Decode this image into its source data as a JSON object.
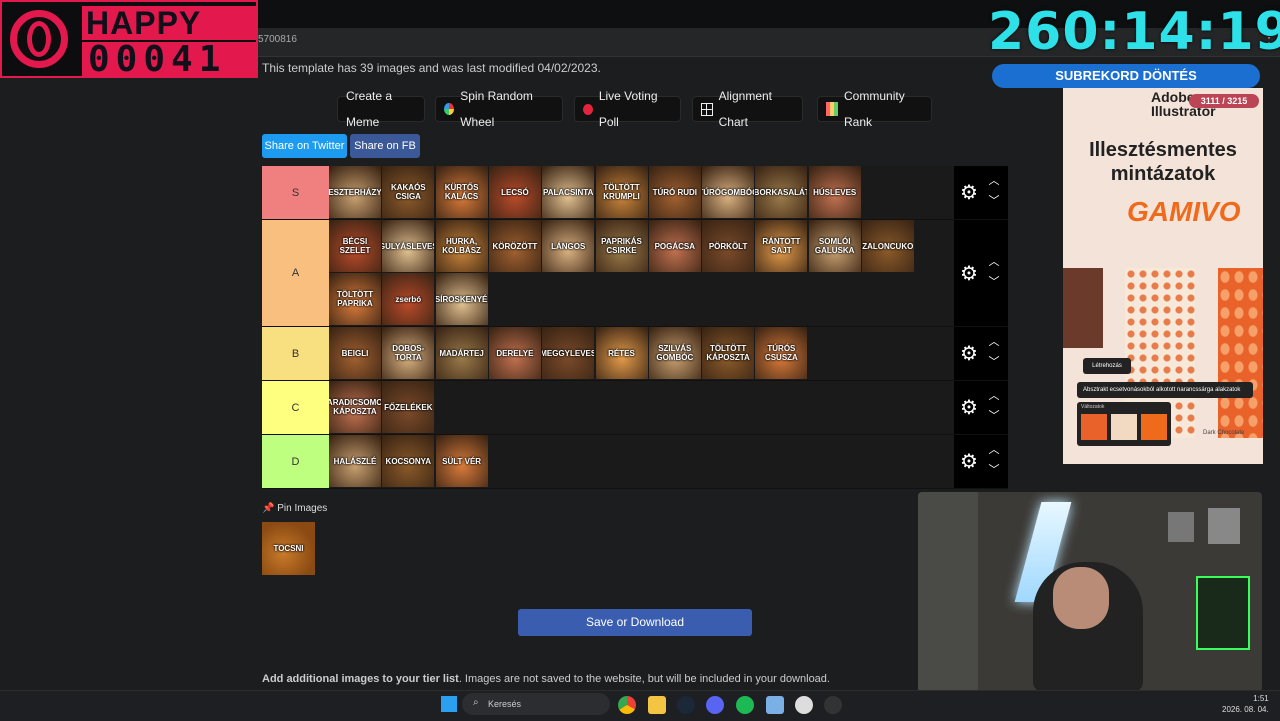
{
  "browser": {
    "url_fragment": "5700816"
  },
  "logo": {
    "line1": "HAPPY PCs",
    "line2": "00041"
  },
  "stream": {
    "timer": "260:14:19",
    "sub_banner": "SUBREKORD DÖNTÉS"
  },
  "template_info": "This template has 39 images and was last modified 04/02/2023.",
  "toolbar": {
    "create_meme": "Create a Meme",
    "spin_wheel": "Spin Random Wheel",
    "live_poll": "Live Voting Poll",
    "alignment": "Alignment Chart",
    "community": "Community Rank"
  },
  "share": {
    "twitter": "Share on Twitter",
    "fb": "Share on FB"
  },
  "tiers": [
    {
      "label": "S",
      "color": "#f07f7f"
    },
    {
      "label": "A",
      "color": "#f8bf7f"
    },
    {
      "label": "B",
      "color": "#f8df7f"
    },
    {
      "label": "C",
      "color": "#ffff7f"
    },
    {
      "label": "D",
      "color": "#bfff7f"
    }
  ],
  "tier_items": {
    "S": [
      "ESZTERHÁZY",
      "KAKAÓS CSIGA",
      "KÜRTŐS KALÁCS",
      "LECSÓ",
      "PALACSINTA",
      "TÖLTÖTT KRUMPLI",
      "TÚRÓ RUDI",
      "TÚRÓGOMBÓC",
      "UBORKASALÁTA",
      "HÚSLEVES"
    ],
    "A": [
      "BÉCSI SZELET",
      "GULYÁSLEVES",
      "HURKA, KOLBÁSZ",
      "KÖRÖZÖTT",
      "LÁNGOS",
      "PAPRIKÁS CSIRKE",
      "POGÁCSA",
      "PÖRKÖLT",
      "RÁNTOTT SAJT",
      "SOMLÓI GALUSKA",
      "SZALONCUKOR",
      "TÖLTÖTT PAPRIKA",
      "zserbó",
      "ZSÍROSKENYÉR"
    ],
    "B": [
      "BEIGLI",
      "DOBOS-TORTA",
      "MADÁRTEJ",
      "DERELYE",
      "MEGGYLEVES",
      "RÉTES",
      "SZILVÁS GOMBÓC",
      "TÖLTÖTT KÁPOSZTA",
      "TÚRÓS CSUSZA"
    ],
    "C": [
      "PARADICSOMOS KÁPOSZTA",
      "FŐZELÉKEK"
    ],
    "D": [
      "HALÁSZLÉ",
      "KOCSONYA",
      "SÜLT VÉR"
    ]
  },
  "pin": {
    "label": "Pin Images",
    "item": "TOCSNI"
  },
  "save_label": "Save or Download",
  "add_images": {
    "bold": "Add additional images to your tier list",
    "rest": ". Images are not saved to the website, but will be included in your download."
  },
  "ad": {
    "brand": "Adobe Illustrator",
    "counter": "3111 / 3215",
    "headline": "Illesztésmentes mintázatok",
    "sponsor": "GAMIVO",
    "chip1": "Létrehozás",
    "prompt": "Absztrakt ecsetvonásokból alkotott narancssárga alakzatok",
    "variations": "Változatok",
    "chocolate": "Dark Chocolate"
  },
  "taskbar": {
    "search": "Keresés",
    "time": "1:51",
    "date": "2026. 08. 04."
  },
  "colors": {
    "accent": "#e3184c",
    "timer": "#2ee0e8",
    "save": "#3a5db0",
    "twitter": "#1d9bf0",
    "fb": "#3b5998"
  }
}
